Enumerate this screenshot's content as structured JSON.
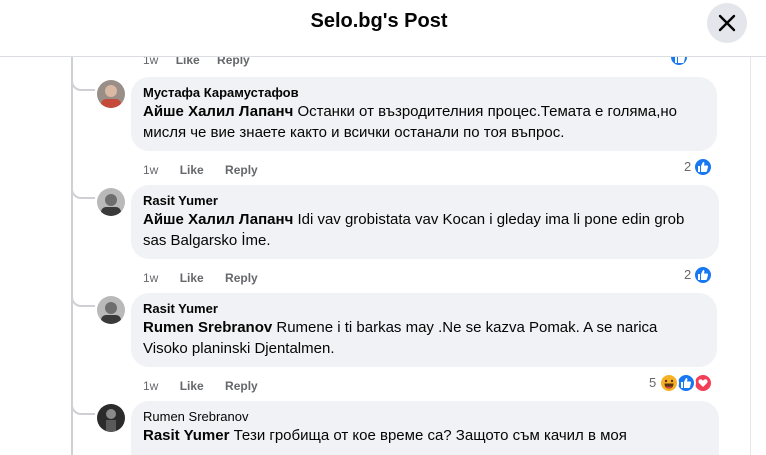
{
  "header": {
    "title": "Selo.bg's Post"
  },
  "top_actions": {
    "time": "1w",
    "like": "Like",
    "reply": "Reply"
  },
  "comments": [
    {
      "author": "Мустафа Карамустафов",
      "mention": "Айше Халил Лапанч",
      "text": " Останки от възродителния процес.Темата е голяма,но мисля че вие знаете както и всички останали по тоя въпрос.",
      "time": "1w",
      "like": "Like",
      "reply": "Reply",
      "reaction_count": "2",
      "reactions": [
        "like-icon"
      ]
    },
    {
      "author": "Rasit Yumer",
      "mention": "Айше Халил Лапанч",
      "text": " Idi vav grobistata vav Kocan i gleday ima li pone edin grob sas Balgarsko İme.",
      "time": "1w",
      "like": "Like",
      "reply": "Reply",
      "reaction_count": "2",
      "reactions": [
        "like-icon"
      ]
    },
    {
      "author": "Rasit Yumer",
      "mention": "Rumen Srebranov",
      "text": " Rumene i ti barkas may .Ne se kazva Pomak. A se narica Visoko planinski Djentalmen.",
      "time": "1w",
      "like": "Like",
      "reply": "Reply",
      "reaction_count": "5",
      "reactions": [
        "haha-icon",
        "like-icon",
        "love-icon"
      ]
    },
    {
      "author": "Rumen Srebranov",
      "mention": "Rasit Yumer",
      "text": " Тези гробища от кое време са? Защото съм качил в моя",
      "time": "",
      "like": "",
      "reply": "",
      "reaction_count": "",
      "reactions": []
    }
  ],
  "colors": {
    "like_blue": "#1877f2",
    "love_red": "#f33e58",
    "haha_yellow": "#f7b125",
    "bubble_bg": "#f0f2f5",
    "meta_gray": "#65676b"
  }
}
